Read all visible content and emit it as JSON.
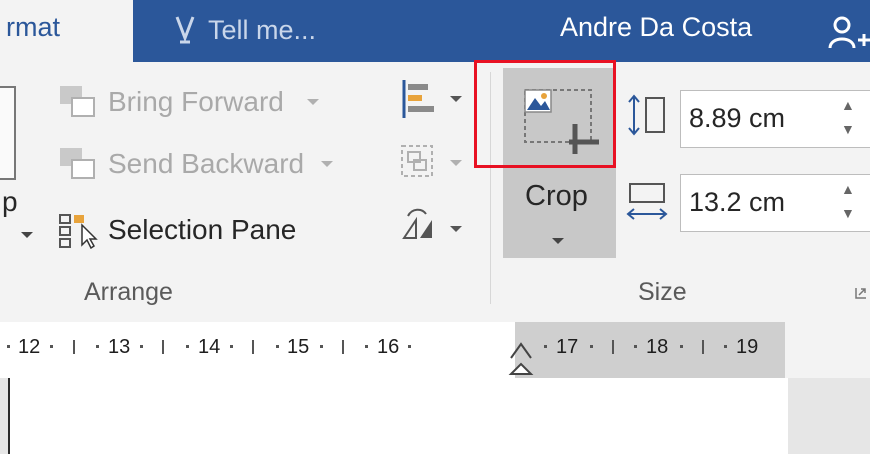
{
  "tabs": {
    "format": "rmat",
    "tell_me": "Tell me...",
    "user": "Andre Da Costa"
  },
  "arrange": {
    "partial_label": "p",
    "bring_forward": "Bring Forward",
    "send_backward": "Send Backward",
    "selection_pane": "Selection Pane",
    "group_label": "Arrange"
  },
  "size": {
    "crop_label": "Crop",
    "height_value": "8.89 cm",
    "width_value": "13.2 cm",
    "group_label": "Size"
  },
  "ruler": {
    "numbers": [
      "12",
      "13",
      "14",
      "15",
      "16",
      "17",
      "18",
      "19"
    ]
  },
  "colors": {
    "accent": "#2b579a",
    "highlight": "#e81123",
    "pressed": "#c8c8c8"
  }
}
